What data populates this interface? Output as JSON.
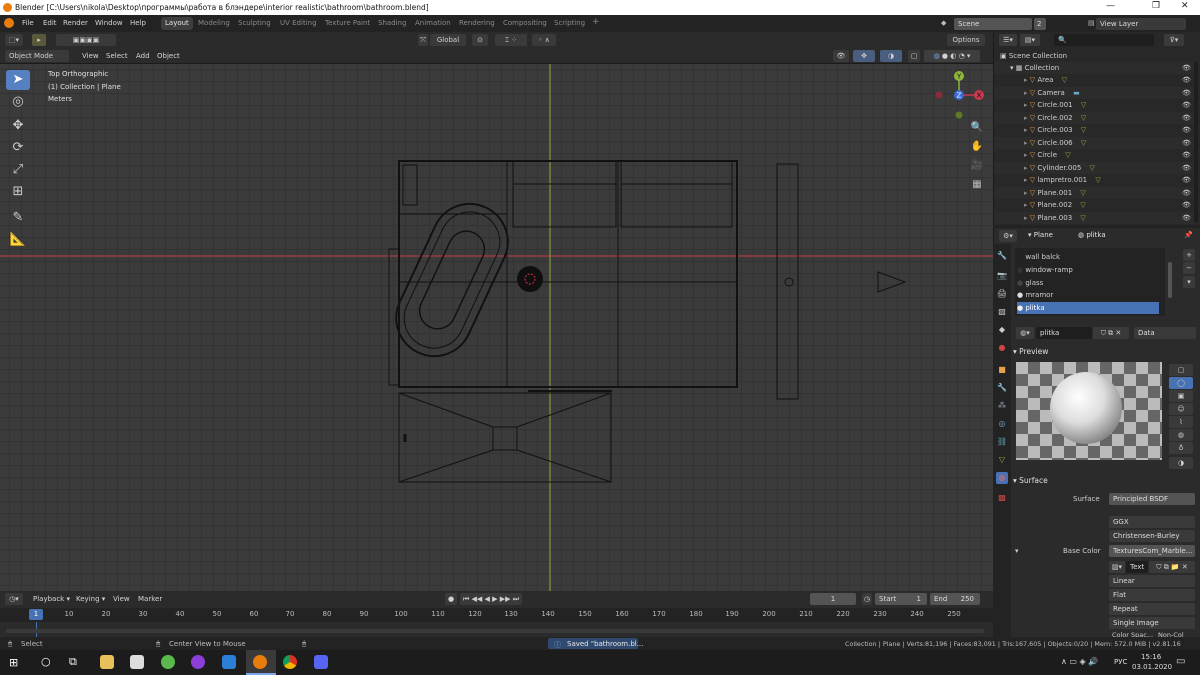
{
  "titlebar": {
    "title": "Blender [C:\\Users\\nikola\\Desktop\\программы\\работа в блэндере\\interior realistic\\bathroom\\bathroom.blend]",
    "minimize": "—",
    "maximize": "❐",
    "close": "✕"
  },
  "menu": {
    "items": [
      "File",
      "Edit",
      "Render",
      "Window",
      "Help"
    ],
    "workspaces": [
      "Layout",
      "Modeling",
      "Sculpting",
      "UV Editing",
      "Texture Paint",
      "Shading",
      "Animation",
      "Rendering",
      "Compositing",
      "Scripting"
    ],
    "add_tab": "+",
    "scene": "Scene",
    "scene_users": "2",
    "view_layer": "View Layer"
  },
  "viewport_header": {
    "mode": "Object Mode",
    "view": "View",
    "select": "Select",
    "add": "Add",
    "object": "Object",
    "orientation": "Global",
    "options": "Options"
  },
  "overlay": {
    "view_name": "Top Orthographic",
    "collection": "(1) Collection | Plane",
    "units": "Meters"
  },
  "gizmo": {
    "y": "Y",
    "z": "Z",
    "x": "X"
  },
  "timeline": {
    "playback": "Playback",
    "keying": "Keying",
    "view": "View",
    "marker": "Marker",
    "current_frame": "1",
    "start_label": "Start",
    "start": "1",
    "end_label": "End",
    "end": "250",
    "ticks": [
      "1",
      "10",
      "20",
      "30",
      "40",
      "50",
      "60",
      "70",
      "80",
      "90",
      "100",
      "110",
      "120",
      "130",
      "140",
      "150",
      "160",
      "170",
      "180",
      "190",
      "200",
      "210",
      "220",
      "230",
      "240",
      "250"
    ]
  },
  "status": {
    "select": "Select",
    "center": "Center View to Mouse",
    "saved": "Saved \"bathroom.bl...",
    "stats": "Collection | Plane | Verts:81,196 | Faces:83,091 | Tris:167,605 | Objects:0/20 | Mem: 572.0 MiB | v2.81.16"
  },
  "outliner": {
    "root": "Scene Collection",
    "collection": "Collection",
    "items": [
      {
        "name": "Area",
        "color": "#e8a04a"
      },
      {
        "name": "Camera",
        "color": "#e8a04a"
      },
      {
        "name": "Circle.001",
        "color": "#e8a04a"
      },
      {
        "name": "Circle.002",
        "color": "#e8a04a"
      },
      {
        "name": "Circle.003",
        "color": "#e8a04a"
      },
      {
        "name": "Circle.006",
        "color": "#e8a04a"
      },
      {
        "name": "Circle",
        "color": "#e8a04a"
      },
      {
        "name": "Cylinder.005",
        "color": "#e8a04a"
      },
      {
        "name": "lampretro.001",
        "color": "#e8a04a"
      },
      {
        "name": "Plane.001",
        "color": "#e8a04a"
      },
      {
        "name": "Plane.002",
        "color": "#e8a04a"
      },
      {
        "name": "Plane.003",
        "color": "#e8a04a"
      }
    ]
  },
  "properties": {
    "object": "Plane",
    "material": "plitka",
    "slots": [
      "wall balck",
      "window-ramp",
      "glass",
      "mramor",
      "plitka"
    ],
    "material_field": "plitka",
    "link": "Data",
    "preview": "Preview",
    "surface_section": "Surface",
    "surface_label": "Surface",
    "surface_value": "Principled BSDF",
    "distribution": "GGX",
    "subsurface": "Christensen-Burley",
    "base_color_label": "Base Color",
    "base_color_value": "TexturesCom_Marble...",
    "text_field": "Text",
    "interp": "Linear",
    "projection": "Flat",
    "extension": "Repeat",
    "source": "Single Image",
    "color_space": "Color Spac...",
    "non_color": "Non-Col"
  },
  "taskbar": {
    "time": "15:16",
    "date": "03.01.2020",
    "lang": "РУС"
  },
  "colors": {
    "accent": "#5680c2",
    "selected_row": "#4772b3",
    "x_axis": "#c8384f",
    "y_axis": "#8cb63c"
  }
}
